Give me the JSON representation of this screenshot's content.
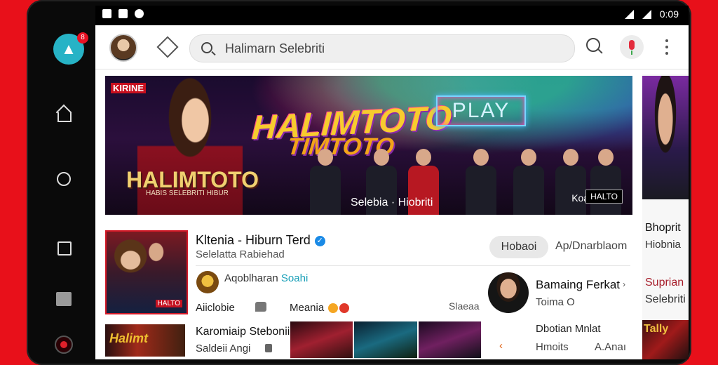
{
  "status_bar": {
    "time": "0:09",
    "icons": [
      "sim-icon",
      "signal-icon",
      "wifi-icon",
      "battery-icon"
    ]
  },
  "nav_rail": {
    "app_badge_count": "8",
    "items": [
      "home-icon",
      "circle-icon",
      "square-icon",
      "stop-icon",
      "record-icon"
    ]
  },
  "top_bar": {
    "search_placeholder": "Halimarn Selebriti"
  },
  "banner": {
    "tag": "KIRINE",
    "title_big": "HALIMTOTO",
    "title_sub": "TIMTOTO",
    "logo": "PLAY",
    "name_left": "HALIMTOTO",
    "name_left_sub": "HABIS SELEBRITI HIBUR",
    "caption": "Selebia · Hiobriti",
    "mini_label": "Koat",
    "mini_tag": "HALTO"
  },
  "right_peek": {
    "title1": "Bhoprit",
    "title2": "Hiobnia",
    "title3": "Suprian",
    "title4": "Selebriti",
    "thumb_text": "Tally"
  },
  "channel": {
    "name": "Kltenia - Hiburn Terd",
    "subtitle": "Selelatta Rabiehad",
    "thumb_label": "HALTO",
    "primary_button": "Hobaoi",
    "secondary_button": "Ap/Dnarblaom"
  },
  "comment": {
    "name": "Aqoblharan",
    "highlight": "Soahi"
  },
  "row": {
    "left": "Aiiclobie",
    "mid": "Meania",
    "right": "Slaeaa"
  },
  "featured": {
    "title": "Bamaing Ferkat",
    "arrow": "›",
    "subtitle": "Toima O"
  },
  "bottom_item": {
    "thumb_text": "Halimt",
    "title": "Karomiaip Stebonii",
    "subtitle": "Saldeii Angi"
  },
  "bottom_right": {
    "line1": "Dbotian Mnlat",
    "line2": "Hmoits",
    "line3": "A.Anaı"
  }
}
